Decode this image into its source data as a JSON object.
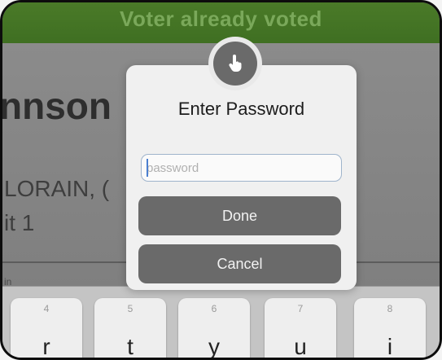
{
  "banner": {
    "text": "Voter already voted"
  },
  "background": {
    "name_fragment": "nnson",
    "city_fragment": "LORAIN, (",
    "unit_fragment": "it 1",
    "small_fragment": "in"
  },
  "dialog": {
    "icon": "hand-pointer-icon",
    "title": "Enter Password",
    "password_placeholder": "password",
    "password_value": "",
    "done_label": "Done",
    "cancel_label": "Cancel"
  },
  "keyboard": {
    "keys": [
      {
        "number": "4",
        "letter": "r"
      },
      {
        "number": "5",
        "letter": "t"
      },
      {
        "number": "6",
        "letter": "y"
      },
      {
        "number": "7",
        "letter": "u"
      },
      {
        "number": "8",
        "letter": "i"
      }
    ]
  },
  "colors": {
    "banner": "#3f6f22",
    "dialog_button": "#6a6a6a",
    "input_border": "#9fb4cc"
  }
}
